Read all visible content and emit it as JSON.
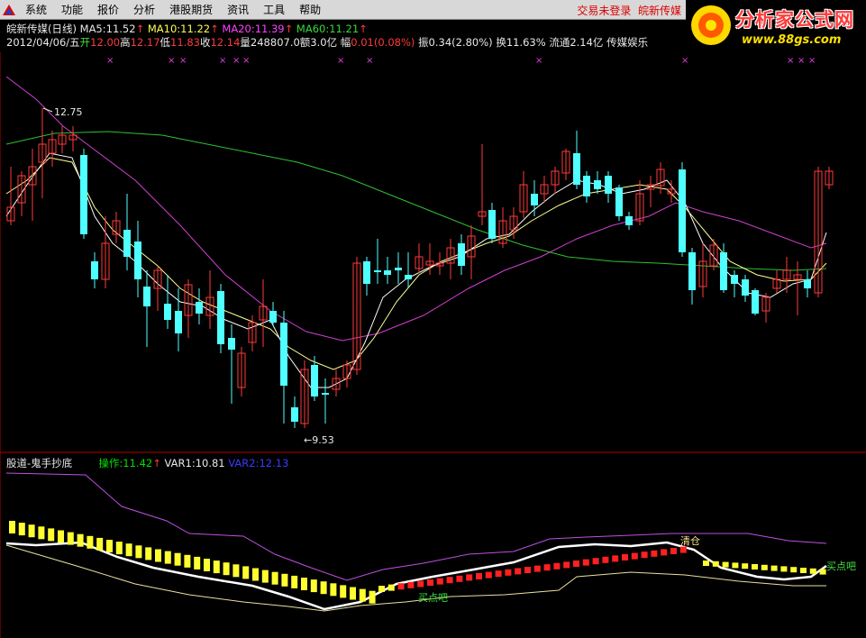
{
  "menu": {
    "items": [
      "系统",
      "功能",
      "报价",
      "分析",
      "港股期货",
      "资讯",
      "工具",
      "帮助"
    ],
    "status": "交易未登录",
    "stock_tab": "皖新传媒"
  },
  "brand": {
    "title": "分析家公式网",
    "url": "www.88gs.com"
  },
  "header": {
    "stock": "皖新传媒(日线)",
    "ma5_label": "MA5:",
    "ma5": "11.52",
    "ma10_label": "MA10:",
    "ma10": "11.22",
    "ma20_label": "MA20:",
    "ma20": "11.39",
    "ma60_label": "MA60:",
    "ma60": "11.21",
    "up_arrow": "↑",
    "date": "2012/04/06/五",
    "open_label": "开",
    "open": "12.00",
    "high_label": "高",
    "high": "12.17",
    "low_label": "低",
    "low": "11.83",
    "close_label": "收",
    "close": "12.14",
    "volume_label": "量",
    "volume": "248807.0",
    "amount_label": "额",
    "amount": "3.0亿",
    "change_label": "幅",
    "change": "0.01(0.08%)",
    "amplitude_label": "振",
    "amplitude": "0.34(2.80%)",
    "turnover_label": "换",
    "turnover": "11.63%",
    "float_label": "流通",
    "float": "2.14亿",
    "sector": "传媒娱乐"
  },
  "price_chart": {
    "high_marker": "12.75",
    "low_marker": "←9.53",
    "colors": {
      "up": "#ff3a3a",
      "down": "#50ffff",
      "ma5": "#ffffff",
      "ma10": "#ffff90",
      "ma20": "#d040d0",
      "ma60": "#30c030"
    }
  },
  "indicator": {
    "name": "股道-鬼手抄底",
    "op_label": "操作:",
    "op_value": "11.42",
    "up_arrow": "↑",
    "var1_label": "VAR1:",
    "var1": "10.81",
    "var2_label": "VAR2:",
    "var2": "12.13",
    "labels": {
      "clear": "清仓",
      "buy1": "买点吧",
      "buy2": "买点吧"
    }
  }
}
